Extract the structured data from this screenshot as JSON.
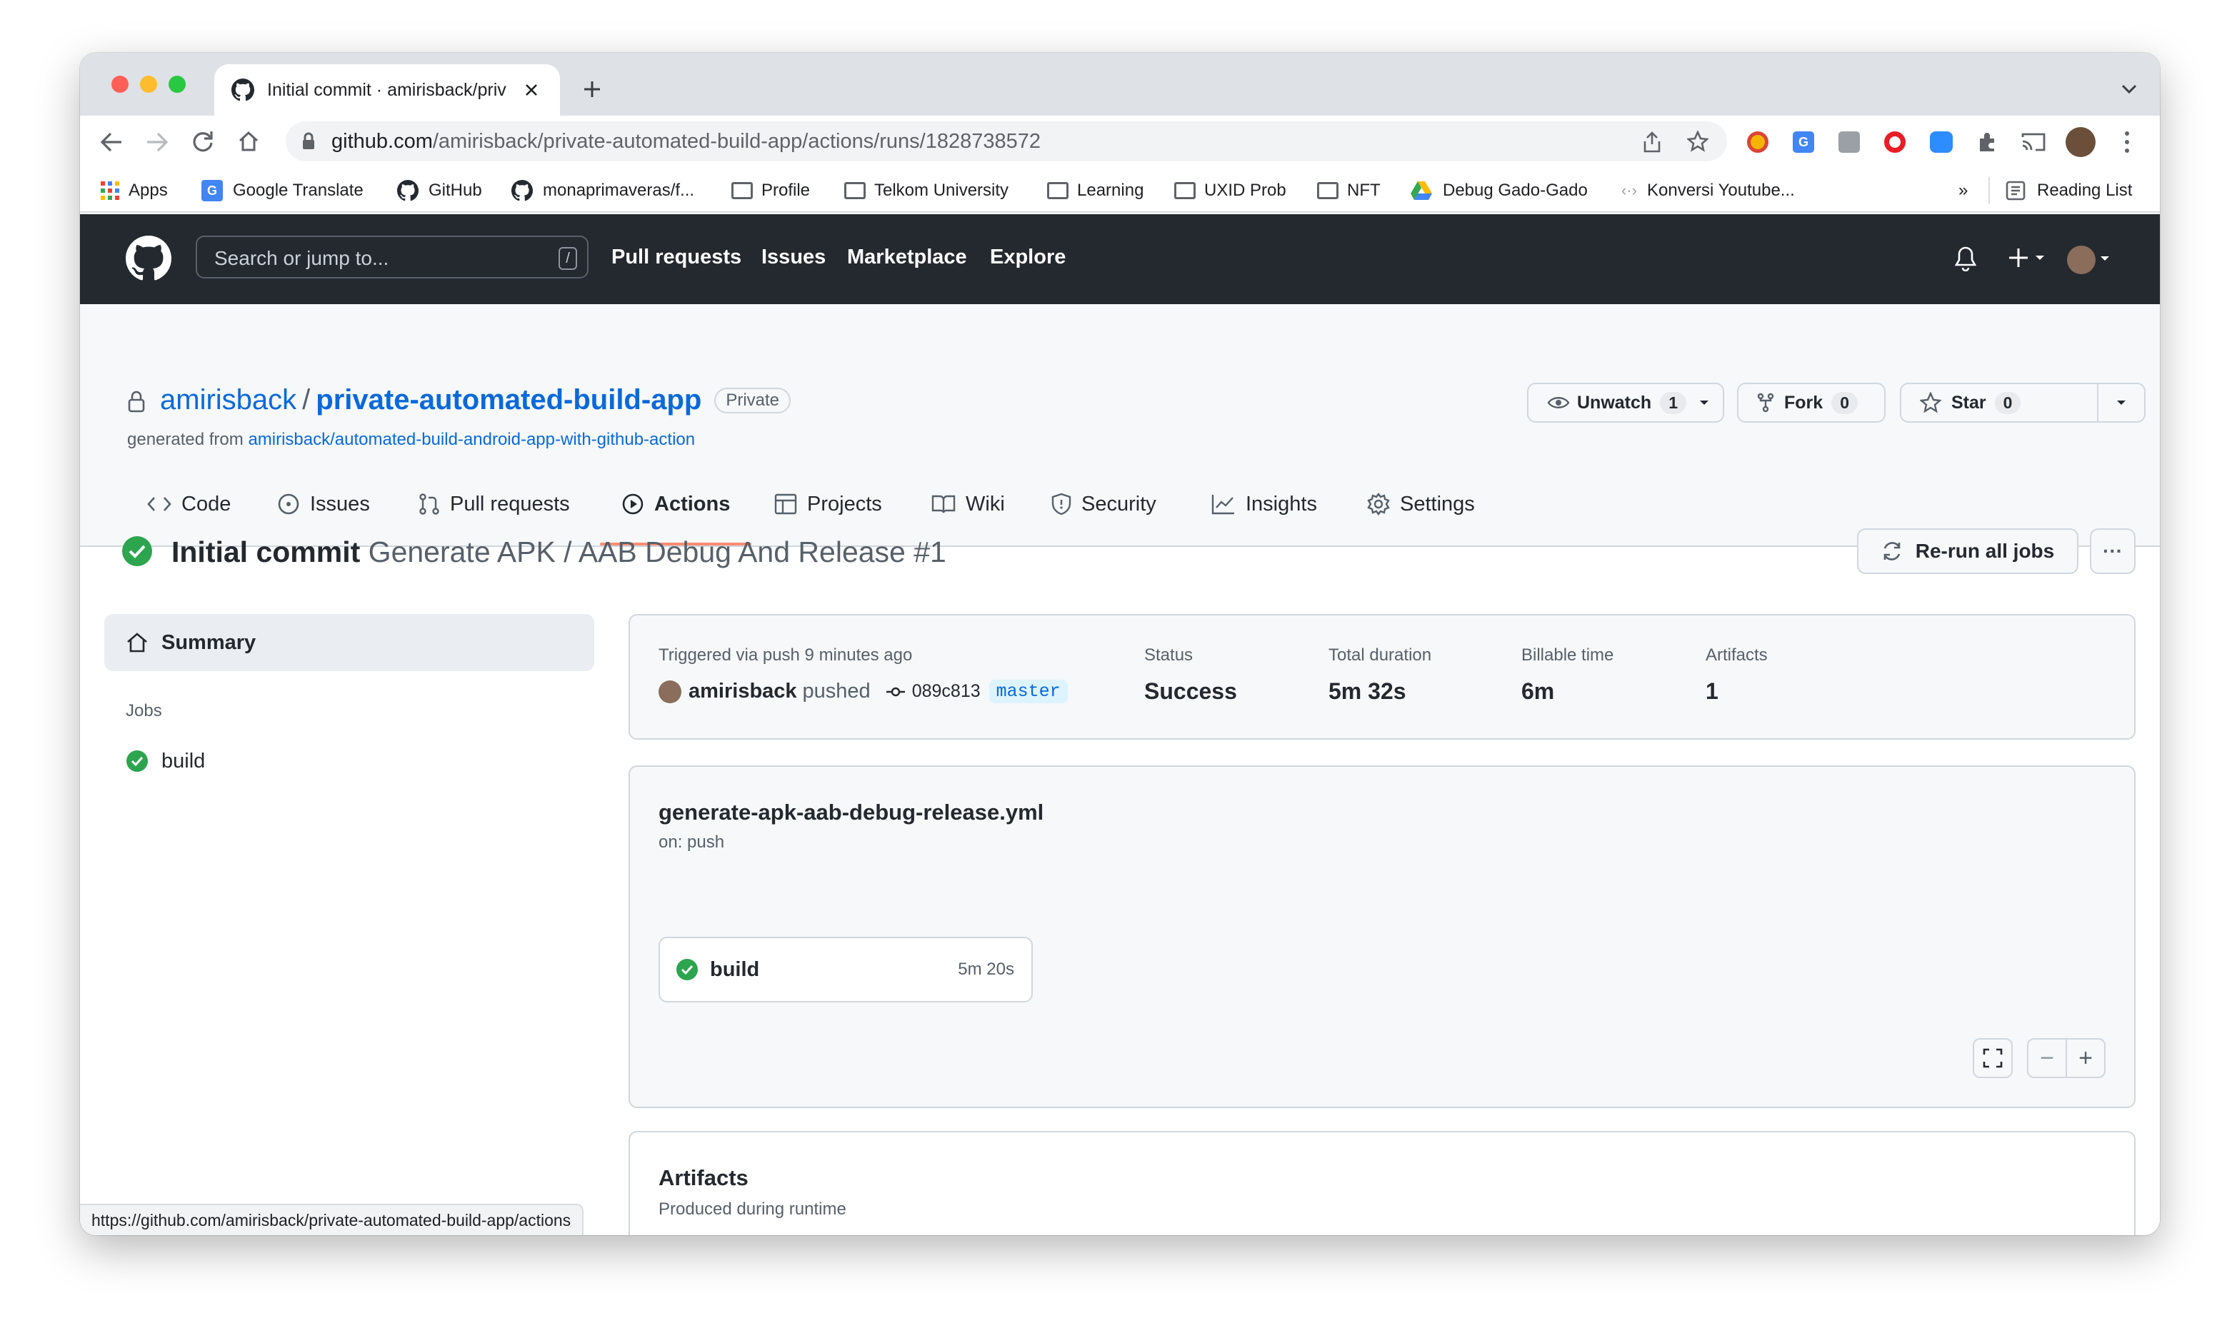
{
  "browser": {
    "tab_title": "Initial commit · amirisback/priv",
    "url_host": "github.com",
    "url_path": "/amirisback/private-automated-build-app/actions/runs/1828738572",
    "status_url": "https://github.com/amirisback/private-automated-build-app/actions",
    "bookmarks": [
      {
        "label": "Apps",
        "icon": "apps-grid-icon"
      },
      {
        "label": "Google Translate",
        "icon": "google-translate-icon"
      },
      {
        "label": "GitHub",
        "icon": "github-icon"
      },
      {
        "label": "monaprimaveras/f...",
        "icon": "github-icon"
      },
      {
        "label": "Profile",
        "icon": "folder-icon"
      },
      {
        "label": "Telkom University",
        "icon": "folder-icon"
      },
      {
        "label": "Learning",
        "icon": "folder-icon"
      },
      {
        "label": "UXID Prob",
        "icon": "folder-icon"
      },
      {
        "label": "NFT",
        "icon": "folder-icon"
      },
      {
        "label": "Debug Gado-Gado",
        "icon": "google-drive-icon"
      },
      {
        "label": "Konversi Youtube...",
        "icon": "code-icon"
      }
    ],
    "overflow": "»",
    "reading_list": "Reading List"
  },
  "github": {
    "search_placeholder": "Search or jump to...",
    "search_key": "/",
    "nav": [
      "Pull requests",
      "Issues",
      "Marketplace",
      "Explore"
    ]
  },
  "repo": {
    "owner": "amirisback",
    "separator": "/",
    "name": "private-automated-build-app",
    "visibility": "Private",
    "generated_prefix": "generated from",
    "generated_link": "amirisback/automated-build-android-app-with-github-action",
    "unwatch_label": "Unwatch",
    "unwatch_count": "1",
    "fork_label": "Fork",
    "fork_count": "0",
    "star_label": "Star",
    "star_count": "0",
    "tabs": [
      "Code",
      "Issues",
      "Pull requests",
      "Actions",
      "Projects",
      "Wiki",
      "Security",
      "Insights",
      "Settings"
    ],
    "active_tab": "Actions"
  },
  "run": {
    "title_bold": "Initial commit",
    "title_rest": "Generate APK / AAB Debug And Release #1",
    "rerun_label": "Re-run all jobs",
    "more_label": "···"
  },
  "sidebar": {
    "summary": "Summary",
    "jobs_heading": "Jobs",
    "jobs": [
      "build"
    ]
  },
  "summary": {
    "triggered": "Triggered via push 9 minutes ago",
    "actor": "amirisback",
    "action": "pushed",
    "commit": "089c813",
    "branch": "master",
    "status_label": "Status",
    "status_value": "Success",
    "duration_label": "Total duration",
    "duration_value": "5m 32s",
    "billable_label": "Billable time",
    "billable_value": "6m",
    "artifacts_label": "Artifacts",
    "artifacts_value": "1"
  },
  "workflow": {
    "file": "generate-apk-aab-debug-release.yml",
    "trigger": "on: push",
    "job_name": "build",
    "job_time": "5m 20s",
    "zoom_out": "−",
    "zoom_in": "+"
  },
  "artifacts": {
    "title": "Artifacts",
    "subtitle": "Produced during runtime"
  },
  "colors": {
    "success": "#2da44e",
    "link": "#0969da",
    "header_bg": "#24292f",
    "active_underline": "#fd8c73"
  }
}
